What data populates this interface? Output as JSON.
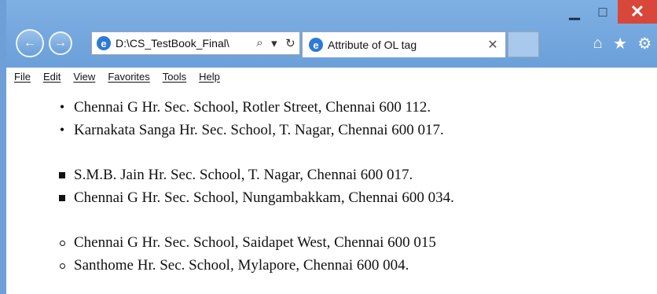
{
  "browser": {
    "address_text": "D:\\CS_TestBook_Final\\",
    "tab_title": "Attribute of OL tag",
    "menu": [
      "File",
      "Edit",
      "View",
      "Favorites",
      "Tools",
      "Help"
    ]
  },
  "lists": {
    "disc": [
      "Chennai G Hr. Sec. School, Rotler Street, Chennai 600 112.",
      "Karnakata Sanga Hr. Sec. School, T. Nagar, Chennai 600 017."
    ],
    "square": [
      "S.M.B. Jain Hr. Sec. School, T. Nagar, Chennai 600 017.",
      "Chennai G Hr. Sec. School, Nungambakkam, Chennai 600 034."
    ],
    "circle": [
      "Chennai G Hr. Sec. School, Saidapet West, Chennai 600 015",
      "Santhome Hr. Sec. School, Mylapore, Chennai 600 004."
    ]
  }
}
